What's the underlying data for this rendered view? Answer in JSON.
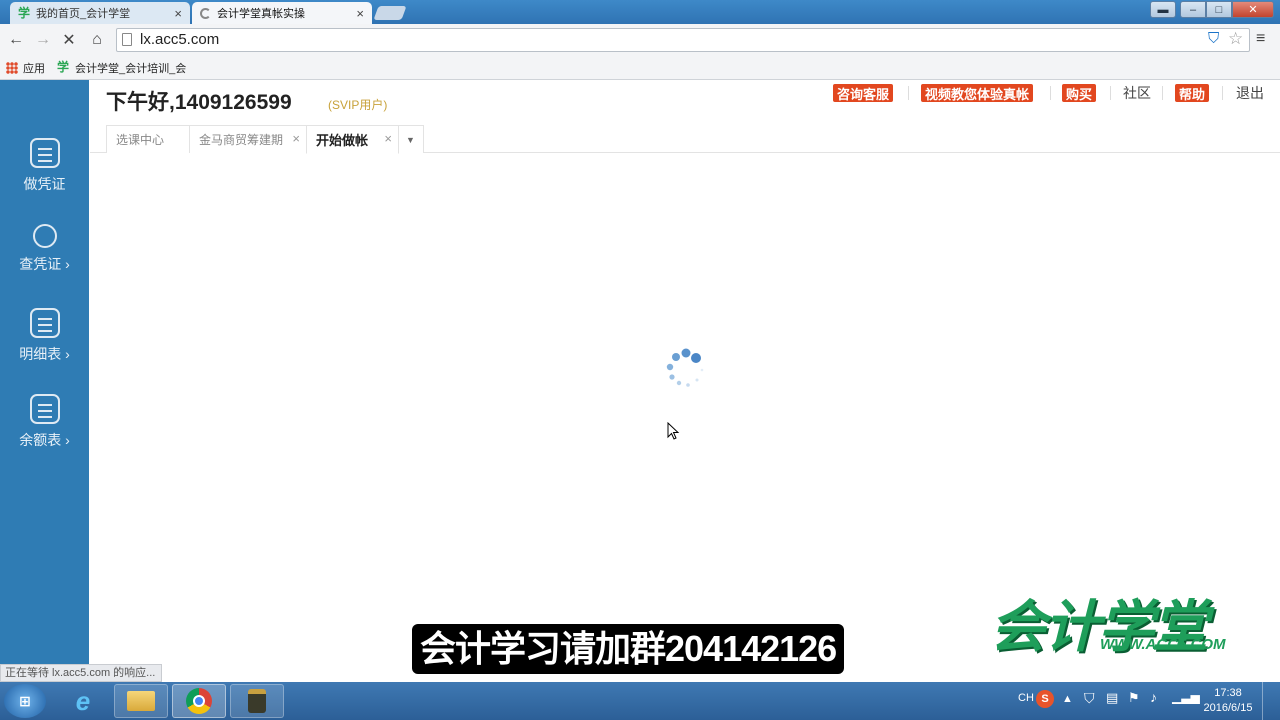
{
  "browser": {
    "tabs": [
      {
        "title": "我的首页_会计学堂",
        "favicon": "学"
      },
      {
        "title": "会计学堂真帐实操"
      }
    ],
    "url": "lx.acc5.com",
    "bookmarks": {
      "apps": "应用",
      "site": "会计学堂_会计培训_会",
      "site_favicon": "学"
    },
    "status": "正在等待 lx.acc5.com 的响应..."
  },
  "sidebar": {
    "items": [
      {
        "label": "做凭证",
        "icon": "calculator-icon"
      },
      {
        "label": "查凭证 ›",
        "icon": "search-icon"
      },
      {
        "label": "明细表 ›",
        "icon": "list-icon"
      },
      {
        "label": "余额表 ›",
        "icon": "list-icon"
      }
    ]
  },
  "header": {
    "greeting": "下午好,1409126599",
    "badge": "(SVIP用户)",
    "buttons": [
      "咨询客服",
      "视频教您体验真帐",
      "购买"
    ],
    "links": [
      "社区"
    ],
    "help": "帮助",
    "logout": "退出"
  },
  "page_tabs": [
    {
      "label": "选课中心"
    },
    {
      "label": "金马商贸筹建期",
      "close": "×"
    },
    {
      "label": "开始做帐",
      "close": "×"
    }
  ],
  "overlay": {
    "subtitle": "会计学习请加群204142126",
    "logo": "会计学堂",
    "logo_url": "WWW.ACC5.COM"
  },
  "taskbar": {
    "lang": "CH",
    "time": "17:38",
    "date": "2016/6/15"
  },
  "colors": {
    "sidebar": "#2f7cb4",
    "accent_button": "#e2471f",
    "brand_green": "#1e9e5a"
  }
}
